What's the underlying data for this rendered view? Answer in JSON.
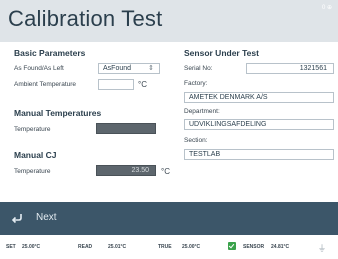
{
  "title": "Calibration Test",
  "corner_text": "0 ⊕",
  "basic": {
    "heading": "Basic Parameters",
    "as_found_label": "As Found/As Left",
    "as_found_value": "AsFound",
    "ambient_label": "Ambient Temperature",
    "ambient_value": "",
    "ambient_unit": "°C"
  },
  "manual_temps": {
    "heading": "Manual Temperatures",
    "temp_label": "Temperature",
    "temp_value": ""
  },
  "manual_cj": {
    "heading": "Manual CJ",
    "temp_label": "Temperature",
    "temp_value": "23.50",
    "unit": "°C"
  },
  "sensor": {
    "heading": "Sensor Under Test",
    "serial_label": "Serial No:",
    "serial_value": "1321561",
    "factory_label": "Factory:",
    "factory_value": "AMETEK DENMARK A/S",
    "department_label": "Department:",
    "department_value": "UDVIKLINGSAFDELING",
    "section_label": "Section:",
    "section_value": "TESTLAB"
  },
  "footer": {
    "back_icon": "back-arrow-icon",
    "next_label": "Next"
  },
  "status": {
    "set_label": "SET",
    "set_value": "25.00°C",
    "read_label": "READ",
    "read_value": "25.01°C",
    "true_label": "TRUE",
    "true_value": "25.00°C",
    "stable_icon": "checkmark-icon",
    "sensor_label": "SENSOR",
    "sensor_value": "24.81°C",
    "power_icon": "plug-icon"
  },
  "colors": {
    "titlebar": "#dfe4e8",
    "footer": "#3c5669",
    "stable": "#3aa24b"
  }
}
